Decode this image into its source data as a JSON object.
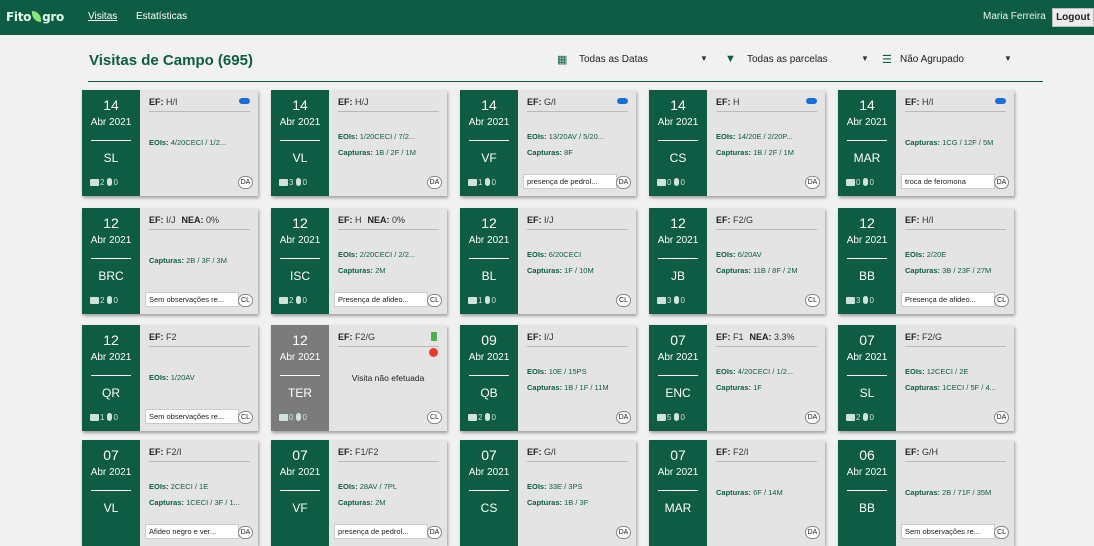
{
  "app": {
    "logo": "Fito",
    "logo_suffix": "gro"
  },
  "nav": {
    "visitas": "Visitas",
    "estatisticas": "Estatísticas"
  },
  "user": {
    "name": "Maria Ferreira",
    "logout": "Logout"
  },
  "header": {
    "title": "Visitas de Campo (695)",
    "filter_dates": "Todas as Datas",
    "filter_parcelas": "Todas as parcelas",
    "filter_group": "Não Agrupado"
  },
  "labels": {
    "efs": "EF:",
    "nea": "NEA:",
    "eois": "EOIs:",
    "capturas": "Capturas:"
  },
  "cards": [
    {
      "day": "14",
      "month": "Abr 2021",
      "code": "SL",
      "photos": "2",
      "audio": "0",
      "ef": "H/I",
      "nea": "",
      "eois": "4/20CECI / 1/2...",
      "capturas": "",
      "obs": "",
      "tag": "DA",
      "weather": true
    },
    {
      "day": "14",
      "month": "Abr 2021",
      "code": "VL",
      "photos": "3",
      "audio": "0",
      "ef": "H/J",
      "nea": "",
      "eois": "1/20CECI / 7/2...",
      "capturas": "1B / 2F / 1M",
      "obs": "",
      "tag": "DA",
      "weather": false
    },
    {
      "day": "14",
      "month": "Abr 2021",
      "code": "VF",
      "photos": "1",
      "audio": "0",
      "ef": "G/I",
      "nea": "",
      "eois": "13/20AV / 5/20...",
      "capturas": "8F",
      "obs": "presença de pedrol...",
      "tag": "DA",
      "weather": true
    },
    {
      "day": "14",
      "month": "Abr 2021",
      "code": "CS",
      "photos": "0",
      "audio": "0",
      "ef": "H",
      "nea": "",
      "eois": "14/20E / 2/20P...",
      "capturas": "1B / 2F / 1M",
      "obs": "",
      "tag": "DA",
      "weather": true
    },
    {
      "day": "14",
      "month": "Abr 2021",
      "code": "MAR",
      "photos": "0",
      "audio": "0",
      "ef": "H/I",
      "nea": "",
      "eois": "",
      "capturas": "1CG / 12F / 5M",
      "obs": "troca de feromona",
      "tag": "DA",
      "weather": true
    },
    {
      "day": "12",
      "month": "Abr 2021",
      "code": "BRC",
      "photos": "2",
      "audio": "0",
      "ef": "I/J",
      "nea": "0%",
      "eois": "",
      "capturas": "2B / 3F / 3M",
      "obs": "Sem observações re...",
      "tag": "CL",
      "weather": false
    },
    {
      "day": "12",
      "month": "Abr 2021",
      "code": "ISC",
      "photos": "2",
      "audio": "0",
      "ef": "H",
      "nea": "0%",
      "eois": "2/20CECI / 2/2...",
      "capturas": "2M",
      "obs": "Presença de afideo...",
      "tag": "CL",
      "weather": false
    },
    {
      "day": "12",
      "month": "Abr 2021",
      "code": "BL",
      "photos": "1",
      "audio": "0",
      "ef": "I/J",
      "nea": "",
      "eois": "6/20CECI",
      "capturas": "1F / 10M",
      "obs": "",
      "tag": "CL",
      "weather": false
    },
    {
      "day": "12",
      "month": "Abr 2021",
      "code": "JB",
      "photos": "3",
      "audio": "0",
      "ef": "F2/G",
      "nea": "",
      "eois": "6/20AV",
      "capturas": "11B / 8F / 2M",
      "obs": "",
      "tag": "CL",
      "weather": false
    },
    {
      "day": "12",
      "month": "Abr 2021",
      "code": "BB",
      "photos": "3",
      "audio": "0",
      "ef": "H/I",
      "nea": "",
      "eois": "2/20E",
      "capturas": "3B / 23F / 27M",
      "obs": "Presença de afideo...",
      "tag": "CL",
      "weather": false
    },
    {
      "day": "12",
      "month": "Abr 2021",
      "code": "QR",
      "photos": "1",
      "audio": "0",
      "ef": "F2",
      "nea": "",
      "eois": "1/20AV",
      "capturas": "",
      "obs": "Sem observações re...",
      "tag": "CL",
      "weather": false
    },
    {
      "day": "12",
      "month": "Abr 2021",
      "code": "TER",
      "photos": "0",
      "audio": "0",
      "ef": "F2/G",
      "nea": "",
      "eois": "",
      "capturas": "",
      "obs": "",
      "tag": "CL",
      "weather": false,
      "not_done": "Visita não efetuada"
    },
    {
      "day": "09",
      "month": "Abr 2021",
      "code": "QB",
      "photos": "2",
      "audio": "0",
      "ef": "I/J",
      "nea": "",
      "eois": "10E / 15PS",
      "capturas": "1B / 1F / 11M",
      "obs": "",
      "tag": "DA",
      "weather": false
    },
    {
      "day": "07",
      "month": "Abr 2021",
      "code": "ENC",
      "photos": "5",
      "audio": "0",
      "ef": "F1",
      "nea": "3.3%",
      "eois": "4/20CECI / 1/2...",
      "capturas": "1F",
      "obs": "",
      "tag": "DA",
      "weather": false
    },
    {
      "day": "07",
      "month": "Abr 2021",
      "code": "SL",
      "photos": "2",
      "audio": "0",
      "ef": "F2/G",
      "nea": "",
      "eois": "12CECI / 2E",
      "capturas": "1CECI / 5F / 4...",
      "obs": "",
      "tag": "DA",
      "weather": false
    },
    {
      "day": "07",
      "month": "Abr 2021",
      "code": "VL",
      "photos": "",
      "audio": "",
      "ef": "F2/I",
      "nea": "",
      "eois": "2CECI / 1E",
      "capturas": "1CECI / 3F / 1...",
      "obs": "Afideo negro e ver...",
      "tag": "DA",
      "weather": false
    },
    {
      "day": "07",
      "month": "Abr 2021",
      "code": "VF",
      "photos": "",
      "audio": "",
      "ef": "F1/F2",
      "nea": "",
      "eois": "28AV / 7PL",
      "capturas": "2M",
      "obs": "presença de pedrol...",
      "tag": "DA",
      "weather": false
    },
    {
      "day": "07",
      "month": "Abr 2021",
      "code": "CS",
      "photos": "",
      "audio": "",
      "ef": "G/I",
      "nea": "",
      "eois": "33E / 3PS",
      "capturas": "1B / 3F",
      "obs": "",
      "tag": "DA",
      "weather": false
    },
    {
      "day": "07",
      "month": "Abr 2021",
      "code": "MAR",
      "photos": "",
      "audio": "",
      "ef": "F2/I",
      "nea": "",
      "eois": "",
      "capturas": "6F / 14M",
      "obs": "",
      "tag": "DA",
      "weather": false
    },
    {
      "day": "06",
      "month": "Abr 2021",
      "code": "BB",
      "photos": "",
      "audio": "",
      "ef": "G/H",
      "nea": "",
      "eois": "",
      "capturas": "2B / 71F / 35M",
      "obs": "Sem observações re...",
      "tag": "CL",
      "weather": false
    }
  ]
}
